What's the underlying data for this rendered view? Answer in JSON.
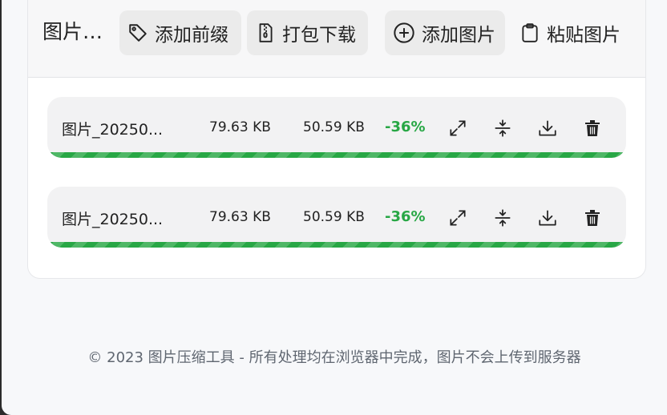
{
  "toolbar": {
    "title": "图片压缩工具",
    "buttons": {
      "add_prefix": "添加前缀",
      "download_zip": "打包下载",
      "add_images": "添加图片",
      "paste_images": "粘贴图片"
    }
  },
  "files": [
    {
      "name": "图片_20250...",
      "original_size": "79.63 KB",
      "compressed_size": "50.59 KB",
      "reduction": "-36%",
      "progress": 1.0
    },
    {
      "name": "图片_20250...",
      "original_size": "79.63 KB",
      "compressed_size": "50.59 KB",
      "reduction": "-36%",
      "progress": 1.0
    }
  ],
  "footer": {
    "text": "© 2023 图片压缩工具 - 所有处理均在浏览器中完成，图片不会上传到服务器"
  },
  "colors": {
    "success": "#28a745",
    "button_bg": "#ebebeb",
    "text": "#222222",
    "muted": "#5f6670"
  },
  "icons": {
    "add_prefix": "tag-icon",
    "download_zip": "zip-file-icon",
    "add_images": "plus-circle-icon",
    "paste_images": "clipboard-icon",
    "row_actions": [
      "expand-icon",
      "compress-icon",
      "download-icon",
      "trash-icon"
    ]
  }
}
